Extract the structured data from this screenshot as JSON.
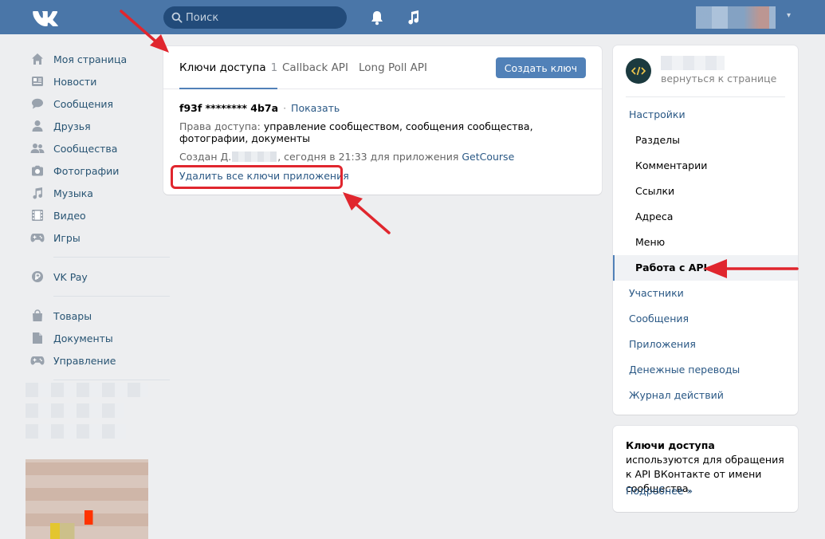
{
  "header": {
    "search_placeholder": "Поиск",
    "profile_caret": "▾"
  },
  "left_nav": {
    "items": [
      {
        "label": "Моя страница",
        "icon": "home-icon"
      },
      {
        "label": "Новости",
        "icon": "news-icon"
      },
      {
        "label": "Сообщения",
        "icon": "message-icon"
      },
      {
        "label": "Друзья",
        "icon": "friend-icon"
      },
      {
        "label": "Сообщества",
        "icon": "groups-icon"
      },
      {
        "label": "Фотографии",
        "icon": "camera-icon"
      },
      {
        "label": "Музыка",
        "icon": "music-icon"
      },
      {
        "label": "Видео",
        "icon": "video-icon"
      },
      {
        "label": "Игры",
        "icon": "gamepad-icon"
      }
    ],
    "vkpay": "VK Pay",
    "extra_items": [
      {
        "label": "Товары",
        "icon": "bag-icon"
      },
      {
        "label": "Документы",
        "icon": "document-icon"
      },
      {
        "label": "Управление",
        "icon": "gamepad-icon"
      }
    ]
  },
  "main": {
    "tabs": [
      {
        "label": "Ключи доступа",
        "count": "1",
        "active": true
      },
      {
        "label": "Callback API",
        "active": false
      },
      {
        "label": "Long Poll API",
        "active": false
      }
    ],
    "create_button": "Создать ключ",
    "key": {
      "value": "f93f ******** 4b7a",
      "separator": "·",
      "show_link": "Показать",
      "rights_label": "Права доступа:",
      "rights_value": "управление сообществом, сообщения сообщества, фотографии, документы",
      "created_prefix": "Создан Д.",
      "created_suffix": ", сегодня в 21:33 для приложения",
      "app_name": "GetCourse"
    },
    "delete_link": "Удалить все ключи приложения"
  },
  "right_panel": {
    "back_link": "вернуться к странице",
    "menu": [
      {
        "label": "Настройки",
        "type": "section"
      },
      {
        "label": "Разделы",
        "type": "sub"
      },
      {
        "label": "Комментарии",
        "type": "sub"
      },
      {
        "label": "Ссылки",
        "type": "sub"
      },
      {
        "label": "Адреса",
        "type": "sub"
      },
      {
        "label": "Меню",
        "type": "sub"
      },
      {
        "label": "Работа с API",
        "type": "active"
      },
      {
        "label": "Участники",
        "type": "section"
      },
      {
        "label": "Сообщения",
        "type": "section"
      },
      {
        "label": "Приложения",
        "type": "section"
      },
      {
        "label": "Денежные переводы",
        "type": "section"
      },
      {
        "label": "Журнал действий",
        "type": "section"
      }
    ]
  },
  "info": {
    "bold": "Ключи доступа",
    "text": " используются для обращения к API ВКонтакте от имени сообщества.",
    "more": "Подробнее »"
  },
  "colors": {
    "header": "#4a76a8",
    "link": "#2a5885",
    "annotation": "#e0262e",
    "button": "#5181b8"
  }
}
